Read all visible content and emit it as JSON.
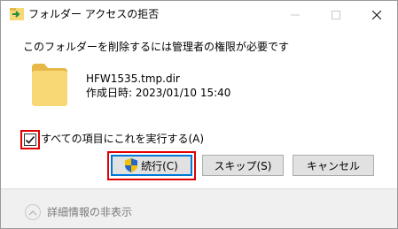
{
  "titlebar": {
    "title": "フォルダー アクセスの拒否"
  },
  "dialog": {
    "message": "このフォルダーを削除するには管理者の権限が必要です",
    "file": {
      "name": "HFW1535.tmp.dir",
      "created": "作成日時: 2023/01/10 15:40"
    },
    "apply_all": {
      "label": "すべての項目にこれを実行する(A)",
      "checked": true
    },
    "buttons": {
      "continue": "続行(C)",
      "skip": "スキップ(S)",
      "cancel": "キャンセル"
    },
    "details_toggle": "詳細情報の非表示"
  },
  "colors": {
    "highlight_frame": "#e00000",
    "focus_border": "#0078d7",
    "folder": "#f8d775"
  },
  "icons": {
    "title": "move-folder-icon",
    "file": "folder-icon",
    "continue": "uac-shield-icon",
    "details": "chevron-up-icon"
  }
}
